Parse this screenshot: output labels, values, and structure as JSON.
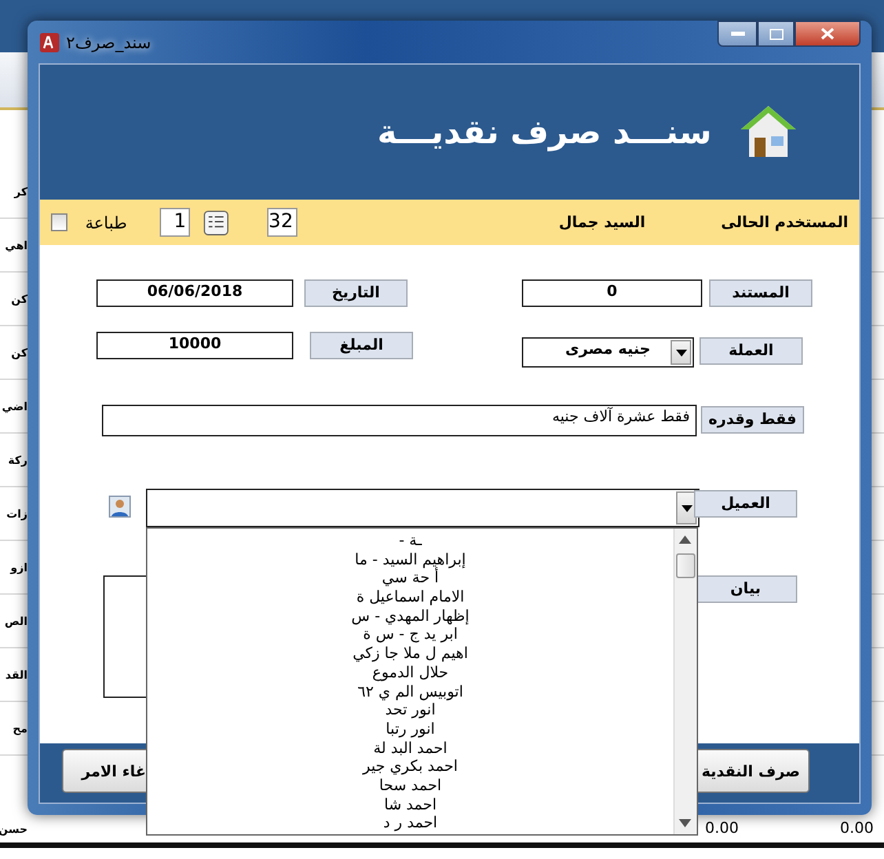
{
  "background_rows": [
    "كر",
    "اهي",
    "كن",
    "كن",
    "اضي",
    "ركة",
    "زات",
    "ازو",
    "الص",
    "القد",
    "مح"
  ],
  "background_bottom": {
    "name": "حسن",
    "column_3": "0.00",
    "column_4": "0.00"
  },
  "window": {
    "title": "سند_صرف٢"
  },
  "header": {
    "title": "سنـــد صرف نقديـــة"
  },
  "user_bar": {
    "label": "المستخدم الحالى",
    "user": "السيد جمال",
    "number": "32",
    "page": "1",
    "print_label": "طباعة",
    "print_checked": false
  },
  "form": {
    "document": {
      "label": "المستند",
      "value": "0"
    },
    "date": {
      "label": "التاريخ",
      "value": "06/06/2018"
    },
    "currency": {
      "label": "العملة",
      "value": "جنيه مصرى"
    },
    "amount": {
      "label": "المبلغ",
      "value": "10000"
    },
    "amount_words": {
      "label": "فقط وقدره",
      "value": "فقط عشرة آلاف جنيه"
    },
    "customer": {
      "label": "العميل"
    },
    "statement": {
      "label": "بيان"
    }
  },
  "customer_options": [
    "ـة -",
    "إبراهيم السيد - ما",
    "أ حة سي",
    "الامام اسماعيل ة",
    "إظهار المهدي - س",
    "ابر يد ج - س ة",
    "اهيم ل ملا جا زكي",
    "حلال الدموع",
    "اتوبيس الم ي ٦٢",
    "انور تحد",
    "انور رتبا",
    "احمد البد لة",
    "احمد بكري جير",
    "احمد سحا",
    "احمد شا",
    "احمد ر د"
  ],
  "buttons": {
    "cancel": "غاء الامر",
    "pay": "صرف النقدية"
  }
}
